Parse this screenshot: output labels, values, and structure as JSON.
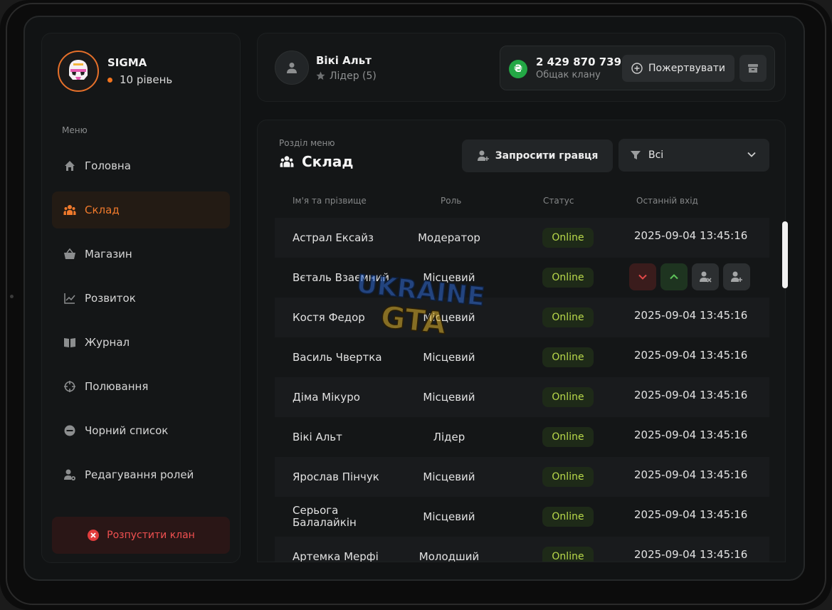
{
  "clan": {
    "name": "SIGMA",
    "level": "10 рівень"
  },
  "sidebar": {
    "menu_label": "Меню",
    "items": [
      {
        "label": "Головна",
        "icon": "home-icon"
      },
      {
        "label": "Склад",
        "icon": "people-icon",
        "active": true
      },
      {
        "label": "Магазин",
        "icon": "basket-icon"
      },
      {
        "label": "Розвиток",
        "icon": "chart-icon"
      },
      {
        "label": "Журнал",
        "icon": "book-icon"
      },
      {
        "label": "Полювання",
        "icon": "crosshair-icon"
      },
      {
        "label": "Чорний список",
        "icon": "minus-circle-icon"
      },
      {
        "label": "Редагування ролей",
        "icon": "user-gear-icon"
      }
    ],
    "disband_label": "Розпустити клан"
  },
  "user": {
    "name": "Вікі Альт",
    "role": "Лідер (5)"
  },
  "bank": {
    "amount": "2 429 870 739",
    "label": "Общак клану",
    "currency_symbol": "₴",
    "donate_label": "Пожертвувати"
  },
  "section": {
    "label": "Розділ меню",
    "title": "Склад",
    "invite_label": "Запросити гравця",
    "filter_value": "Всі"
  },
  "table": {
    "headers": {
      "name": "Ім'я та прізвище",
      "role": "Роль",
      "status": "Статус",
      "last_login": "Останній вхід"
    },
    "rows": [
      {
        "name": "Астрал Ексайз",
        "role": "Модератор",
        "status": "Online",
        "last_login": "2025-09-04 13:45:16"
      },
      {
        "name": "Вєталь Взаємний",
        "role": "Місцевий",
        "status": "Online",
        "last_login": ""
      },
      {
        "name": "Костя Федор",
        "role": "Місцевий",
        "status": "Online",
        "last_login": "2025-09-04 13:45:16"
      },
      {
        "name": "Василь Чвертка",
        "role": "Місцевий",
        "status": "Online",
        "last_login": "2025-09-04 13:45:16"
      },
      {
        "name": "Діма Мікуро",
        "role": "Місцевий",
        "status": "Online",
        "last_login": "2025-09-04 13:45:16"
      },
      {
        "name": "Вікі Альт",
        "role": "Лідер",
        "status": "Online",
        "last_login": "2025-09-04 13:45:16"
      },
      {
        "name": "Ярослав Пінчук",
        "role": "Місцевий",
        "status": "Online",
        "last_login": "2025-09-04 13:45:16"
      },
      {
        "name": "Серьога Балалайкін",
        "role": "Місцевий",
        "status": "Online",
        "last_login": "2025-09-04 13:45:16"
      },
      {
        "name": "Артемка Мерфі",
        "role": "Молодший",
        "status": "Online",
        "last_login": "2025-09-04 13:45:16"
      }
    ]
  },
  "watermark": {
    "line1": "UKRAINE",
    "line2": "GTA"
  },
  "colors": {
    "accent": "#f07a2c",
    "online": "#b9d94a",
    "danger": "#f05050",
    "bank": "#23a845"
  }
}
